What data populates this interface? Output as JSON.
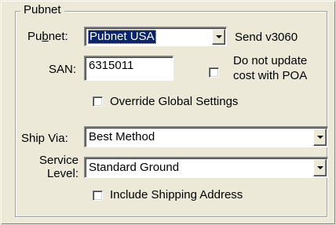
{
  "group": {
    "title": "Pubnet"
  },
  "pubnet": {
    "label_pre": "Pu",
    "label_accel": "b",
    "label_post": "net:",
    "selected": "Pubnet USA",
    "version_text": "Send v3060"
  },
  "san": {
    "label": "SAN:",
    "value": "6315011"
  },
  "do_not_update": {
    "label_line1": "Do not update",
    "label_line2": "cost with POA",
    "checked": false
  },
  "override_global": {
    "label": "Override Global Settings",
    "checked": false
  },
  "ship_via": {
    "label": "Ship Via:",
    "selected": "Best Method"
  },
  "service_level": {
    "label_line1": "Service",
    "label_line2": "Level:",
    "selected": "Standard Ground"
  },
  "include_shipping": {
    "label": "Include Shipping Address",
    "checked": false
  },
  "colors": {
    "window_bg": "#ece9d8",
    "selection_bg": "#0a246a",
    "field_bg": "#ffffff"
  }
}
